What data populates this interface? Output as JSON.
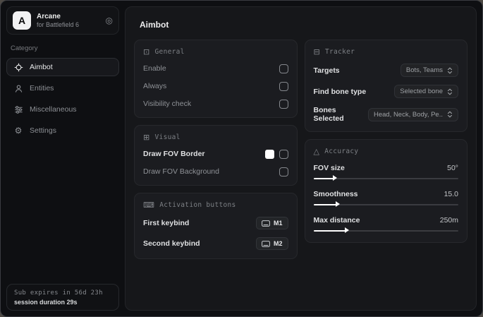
{
  "app": {
    "logo_letter": "A",
    "name": "Arcane",
    "subtitle": "for Battlefield 6"
  },
  "sidebar": {
    "category_label": "Category",
    "items": [
      {
        "label": "Aimbot",
        "icon": "crosshair-icon",
        "active": true
      },
      {
        "label": "Entities",
        "icon": "person-icon",
        "active": false
      },
      {
        "label": "Miscellaneous",
        "icon": "sliders-icon",
        "active": false
      },
      {
        "label": "Settings",
        "icon": "gear-icon",
        "active": false
      }
    ],
    "footer": {
      "expiry": "Sub expires in 56d 23h",
      "session": "session duration 29s"
    }
  },
  "main": {
    "title": "Aimbot",
    "general": {
      "title": "General",
      "rows": [
        {
          "label": "Enable",
          "checked": false
        },
        {
          "label": "Always",
          "checked": false
        },
        {
          "label": "Visibility check",
          "checked": false
        }
      ]
    },
    "visual": {
      "title": "Visual",
      "rows": [
        {
          "label": "Draw FOV Border",
          "swatch_color": "#ffffff",
          "checked": false
        },
        {
          "label": "Draw FOV Background",
          "checked": false
        }
      ]
    },
    "activation": {
      "title": "Activation buttons",
      "rows": [
        {
          "label": "First keybind",
          "key": "M1"
        },
        {
          "label": "Second keybind",
          "key": "M2"
        }
      ]
    },
    "tracker": {
      "title": "Tracker",
      "rows": [
        {
          "label": "Targets",
          "value": "Bots, Teams"
        },
        {
          "label": "Find bone type",
          "value": "Selected bone"
        },
        {
          "label": "Bones Selected",
          "value": "Head, Neck, Body, Pe.."
        }
      ]
    },
    "accuracy": {
      "title": "Accuracy",
      "rows": [
        {
          "label": "FOV size",
          "value": "50°",
          "percent": 14
        },
        {
          "label": "Smoothness",
          "value": "15.0",
          "percent": 16
        },
        {
          "label": "Max distance",
          "value": "250m",
          "percent": 22
        }
      ]
    }
  },
  "colors": {
    "fov_border_swatch": "#ffffff",
    "slider_fill": "#ffffff",
    "panel_bg": "#16171a",
    "card_bg": "#1b1c20"
  }
}
